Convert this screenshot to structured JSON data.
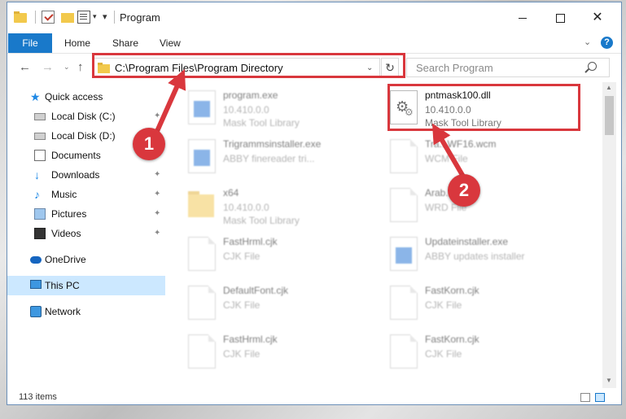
{
  "window": {
    "title": "Program",
    "controls": {
      "minimize": "",
      "maximize": "",
      "close": "✕"
    }
  },
  "quick_access_toolbar": {
    "dropdown_glyph": "▾",
    "pin_glyph": "▾"
  },
  "ribbon": {
    "tabs": [
      "File",
      "Home",
      "Share",
      "View"
    ],
    "collapse_glyph": "⌄",
    "help_glyph": "?"
  },
  "navigation": {
    "back_glyph": "←",
    "forward_glyph": "→",
    "recent_glyph": "⌄",
    "up_glyph": "↑",
    "address": "C:\\Program Files\\Program Directory",
    "address_dropdown_glyph": "⌄",
    "refresh_glyph": "↻",
    "search_placeholder": "Search Program"
  },
  "sidebar": {
    "items": [
      {
        "label": "Quick access",
        "icon": "star-icon",
        "pinned": false
      },
      {
        "label": "Local Disk (C:)",
        "icon": "disk-icon",
        "pinned": true
      },
      {
        "label": "Local Disk (D:)",
        "icon": "disk-icon",
        "pinned": true
      },
      {
        "label": "Documents",
        "icon": "documents-icon",
        "pinned": true
      },
      {
        "label": "Downloads",
        "icon": "download-icon",
        "pinned": true
      },
      {
        "label": "Music",
        "icon": "music-icon",
        "pinned": true
      },
      {
        "label": "Pictures",
        "icon": "pictures-icon",
        "pinned": true
      },
      {
        "label": "Videos",
        "icon": "videos-icon",
        "pinned": true
      },
      {
        "label": "OneDrive",
        "icon": "onedrive-icon",
        "pinned": false
      },
      {
        "label": "This PC",
        "icon": "pc-icon",
        "pinned": false,
        "selected": true
      },
      {
        "label": "Network",
        "icon": "network-icon",
        "pinned": false
      }
    ],
    "pin_glyph": "✦"
  },
  "files": [
    {
      "name": "program.exe",
      "line2": "10.410.0.0",
      "line3": "Mask Tool Library",
      "icon": "exe-icon",
      "highlighted": false
    },
    {
      "name": "pntmask100.dll",
      "line2": "10.410.0.0",
      "line3": "Mask Tool Library",
      "icon": "dll-gear-icon",
      "highlighted": true
    },
    {
      "name": "Trigrammsinstaller.exe",
      "line2": "ABBY finereader tri...",
      "line3": "",
      "icon": "exe-icon",
      "highlighted": false
    },
    {
      "name": "Tra...WF16.wcm",
      "line2": "WCM File",
      "line3": "",
      "icon": "document-icon",
      "highlighted": false
    },
    {
      "name": "x64",
      "line2": "10.410.0.0",
      "line3": "Mask Tool Library",
      "icon": "folder-icon",
      "highlighted": false
    },
    {
      "name": "Arab...",
      "line2": "WRD File",
      "line3": "",
      "icon": "document-icon",
      "highlighted": false
    },
    {
      "name": "FastHrml.cjk",
      "line2": "CJK File",
      "line3": "",
      "icon": "document-icon",
      "highlighted": false
    },
    {
      "name": "Updateinstaller.exe",
      "line2": "ABBY updates installer",
      "line3": "",
      "icon": "exe-icon",
      "highlighted": false
    },
    {
      "name": "DefaultFont.cjk",
      "line2": "CJK File",
      "line3": "",
      "icon": "document-icon",
      "highlighted": false
    },
    {
      "name": "FastKorn.cjk",
      "line2": "CJK File",
      "line3": "",
      "icon": "document-icon",
      "highlighted": false
    },
    {
      "name": "FastHrml.cjk",
      "line2": "CJK File",
      "line3": "",
      "icon": "document-icon",
      "highlighted": false
    },
    {
      "name": "FastKorn.cjk",
      "line2": "CJK File",
      "line3": "",
      "icon": "document-icon",
      "highlighted": false
    }
  ],
  "scrollbar": {
    "up_glyph": "▲",
    "down_glyph": "▼"
  },
  "status": {
    "item_count": "113 items"
  },
  "annotations": {
    "callout_1": "1",
    "callout_2": "2",
    "highlight_color": "#d9373d"
  },
  "colors": {
    "accent": "#1979ca",
    "selection": "#cce8ff",
    "folder": "#f2c94c"
  }
}
